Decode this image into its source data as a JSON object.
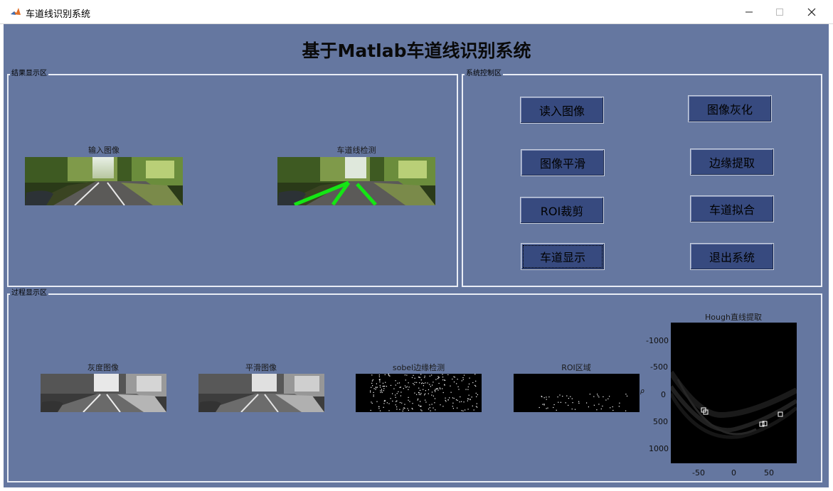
{
  "window": {
    "title": "车道线识别系统",
    "minimize_icon": "minimize-icon",
    "maximize_icon": "maximize-icon",
    "close_icon": "close-icon",
    "app_icon": "matlab-icon"
  },
  "main_title": "基于Matlab车道线识别系统",
  "colors": {
    "background": "#6577a0",
    "button": "#374a7f",
    "panel_border": "#e9edf5",
    "lane_line": "#14e614"
  },
  "result_panel": {
    "label": "结果显示区",
    "input_title": "输入图像",
    "detect_title": "车道线检测"
  },
  "control_panel": {
    "label": "系统控制区",
    "buttons": [
      "读入图像",
      "图像灰化",
      "图像平滑",
      "边缘提取",
      "ROI裁剪",
      "车道拟合",
      "车道显示",
      "退出系统"
    ]
  },
  "process_panel": {
    "label": "过程显示区",
    "gray_title": "灰度图像",
    "smooth_title": "平滑图像",
    "sobel_title": "sobel边缘检测",
    "roi_title": "ROI区域",
    "hough": {
      "title": "Hough直线提取",
      "y_ticks": [
        "-1000",
        "-500",
        "0",
        "500",
        "1000"
      ],
      "x_ticks": [
        "-50",
        "0",
        "50"
      ],
      "y_label": "ρ"
    }
  }
}
